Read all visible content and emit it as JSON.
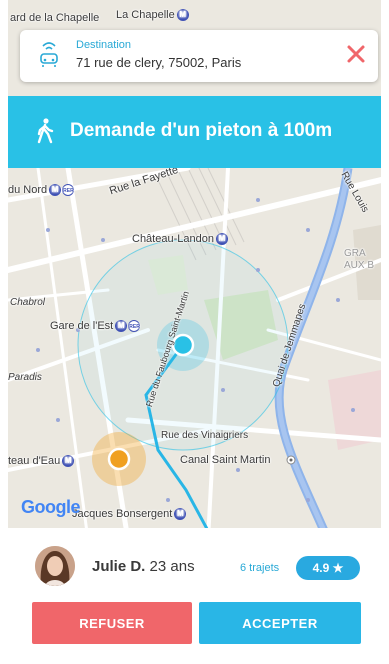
{
  "map": {
    "labels": {
      "la_chapelle_left": "ard de la Chapelle",
      "la_chapelle_station": "La Chapelle",
      "du_nord": "du Nord",
      "rue_la_fayette": "Rue la Fayette",
      "chateau_landon": "Château-Landon",
      "rue_saint_martin": "Rue du Faubourg Saint-Martin",
      "chabrol": "Chabrol",
      "gare_de_lest": "Gare de l'Est",
      "paradis": "Paradis",
      "quai_de_jemmapes": "Quai de Jemmapes",
      "rue_des_vinaigriers": "Rue des Vinaigriers",
      "chateau_deau": "teau d'Eau",
      "canal_saint_martin": "Canal Saint Martin",
      "jacques_bonsergent": "Jacques Bonsergent",
      "rue_louis": "Rue Louis",
      "graux": "GRA AUX B"
    },
    "metro_badge": "M",
    "rer_badge": "RER",
    "google_logo": "Google"
  },
  "destination": {
    "label": "Destination",
    "address": "71 rue de clery, 75002, Paris"
  },
  "banner": {
    "text": "Demande d'un pieton à ",
    "distance": "100m"
  },
  "driver": {
    "name": "Julie D.",
    "age": "23 ans",
    "trips": "6 trajets",
    "rating": "4.9 ★"
  },
  "actions": {
    "refuse_label": "REFUSER",
    "accept_label": "ACCEPTER"
  },
  "colors": {
    "accent": "#29c1e6",
    "refuse": "#f0666a",
    "accept": "#29b6e6",
    "pedestrian_marker": "#f0a020"
  }
}
